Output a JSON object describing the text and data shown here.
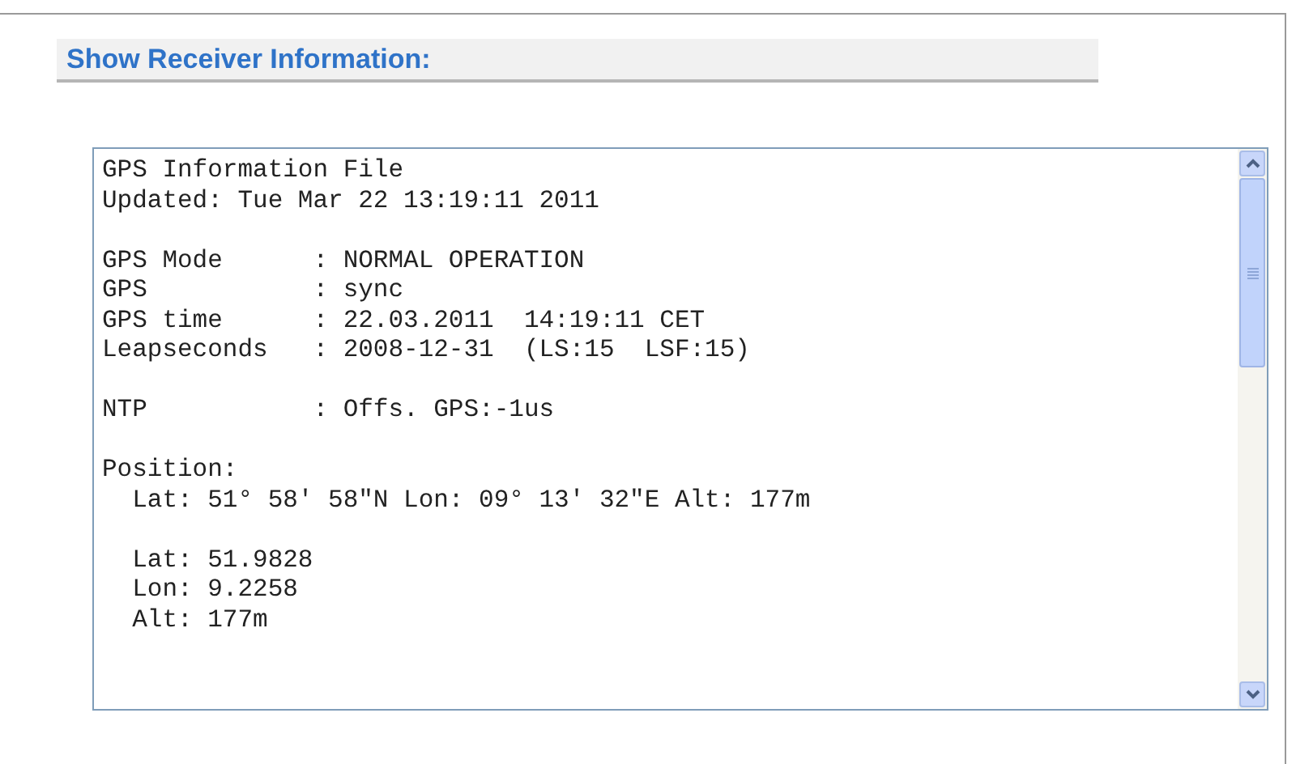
{
  "heading": "Show Receiver Information:",
  "info_text": {
    "paragraphs": [
      [
        "GPS Information File",
        "Updated: Tue Mar 22 13:19:11 2011"
      ],
      [
        "GPS Mode      : NORMAL OPERATION",
        "GPS           : sync",
        "GPS time      : 22.03.2011  14:19:11 CET",
        "Leapseconds   : 2008-12-31  (LS:15  LSF:15)"
      ],
      [
        "NTP           : Offs. GPS:-1us"
      ],
      [
        "Position:",
        "  Lat: 51° 58' 58\"N Lon: 09° 13' 32\"E Alt: 177m"
      ],
      [
        "  Lat: 51.9828",
        "  Lon: 9.2258",
        "  Alt: 177m"
      ]
    ]
  }
}
